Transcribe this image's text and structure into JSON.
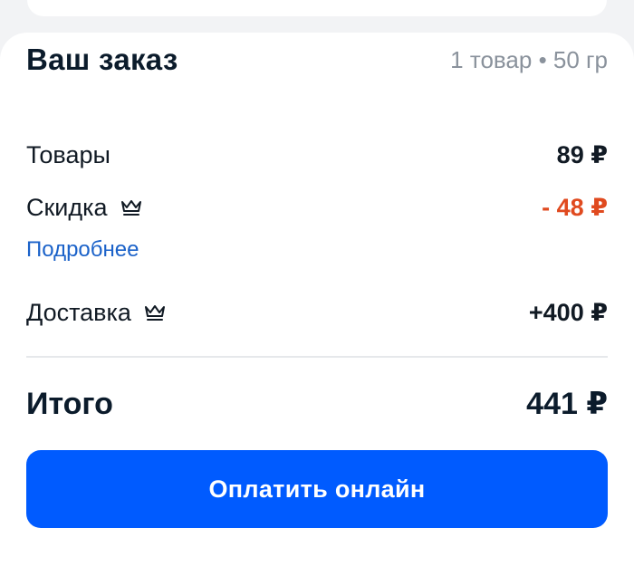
{
  "order": {
    "title": "Ваш заказ",
    "summary": "1 товар • 50 гр"
  },
  "lines": {
    "goods": {
      "label": "Товары",
      "value": "89 ₽"
    },
    "discount": {
      "label": "Скидка",
      "value": "- 48 ₽",
      "icon": "crown-icon",
      "value_color": "#e04a1f"
    },
    "details_link": "Подробнее",
    "delivery": {
      "label": "Доставка",
      "value": "+400 ₽",
      "icon": "crown-icon"
    }
  },
  "total": {
    "label": "Итого",
    "value": "441 ₽"
  },
  "pay_button": {
    "label": "Оплатить онлайн",
    "color": "#005bff"
  }
}
